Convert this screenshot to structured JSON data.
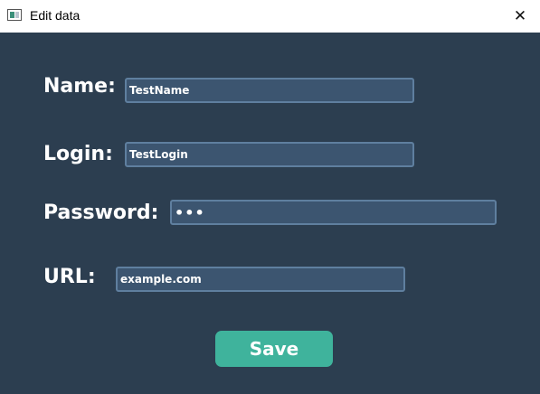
{
  "window": {
    "title": "Edit data",
    "icon": "app-window-icon",
    "close_glyph": "✕"
  },
  "form": {
    "name": {
      "label": "Name:",
      "value": "TestName"
    },
    "login": {
      "label": "Login:",
      "value": "TestLogin"
    },
    "password": {
      "label": "Password:",
      "value": "•••"
    },
    "url": {
      "label": "URL:",
      "value": "example.com"
    }
  },
  "save_label": "Save",
  "colors": {
    "background": "#2c3e50",
    "field_fill": "#3c5570",
    "field_border": "#5f7f9f",
    "accent": "#3fb39c",
    "text": "#ffffff"
  }
}
